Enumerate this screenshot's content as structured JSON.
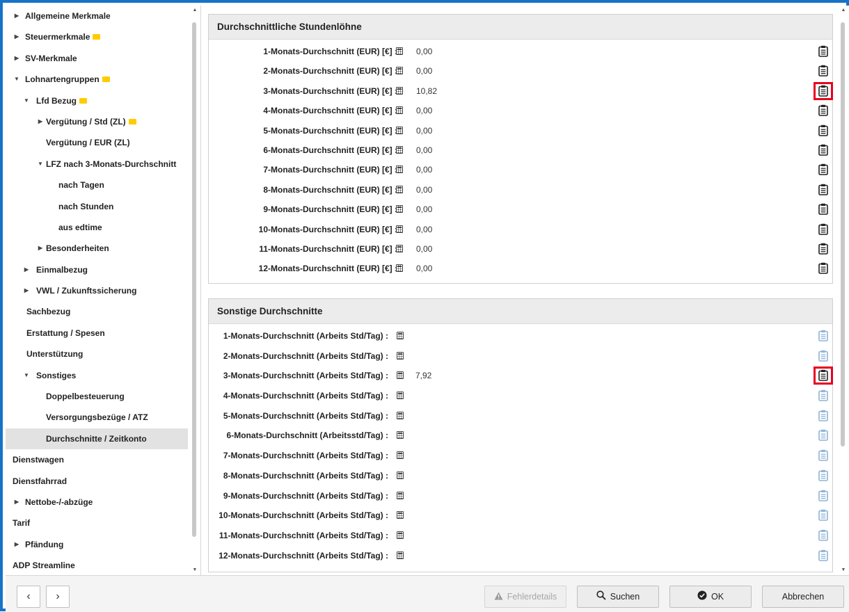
{
  "sidebar": {
    "items": [
      {
        "label": "Allgemeine Merkmale",
        "arrow": "▶",
        "level": 0,
        "flag": false
      },
      {
        "label": "Steuermerkmale",
        "arrow": "▶",
        "level": 0,
        "flag": true
      },
      {
        "label": "SV-Merkmale",
        "arrow": "▶",
        "level": 0,
        "flag": false
      },
      {
        "label": "Lohnartengruppen",
        "arrow": "▼",
        "level": 0,
        "flag": true
      },
      {
        "label": "Lfd Bezug",
        "arrow": "▼",
        "level": 1,
        "flag": true
      },
      {
        "label": "Vergütung / Std (ZL)",
        "arrow": "▶",
        "level": 2,
        "flag": true
      },
      {
        "label": "Vergütung / EUR (ZL)",
        "arrow": "",
        "level": 2,
        "flag": false
      },
      {
        "label": "LFZ nach 3-Monats-Durchschnitt",
        "arrow": "▼",
        "level": 2,
        "flag": false
      },
      {
        "label": "nach Tagen",
        "arrow": "",
        "level": 3,
        "flag": false
      },
      {
        "label": "nach Stunden",
        "arrow": "",
        "level": 3,
        "flag": false
      },
      {
        "label": "aus edtime",
        "arrow": "",
        "level": 3,
        "flag": false
      },
      {
        "label": "Besonderheiten",
        "arrow": "▶",
        "level": 2,
        "flag": false
      },
      {
        "label": "Einmalbezug",
        "arrow": "▶",
        "level": 1,
        "flag": false
      },
      {
        "label": "VWL / Zukunftssicherung",
        "arrow": "▶",
        "level": 1,
        "flag": false
      },
      {
        "label": "Sachbezug",
        "arrow": "",
        "level": 1,
        "flag": false
      },
      {
        "label": "Erstattung / Spesen",
        "arrow": "",
        "level": 1,
        "flag": false
      },
      {
        "label": "Unterstützung",
        "arrow": "",
        "level": 1,
        "flag": false
      },
      {
        "label": "Sonstiges",
        "arrow": "▼",
        "level": 1,
        "flag": false
      },
      {
        "label": "Doppelbesteuerung",
        "arrow": "",
        "level": 2,
        "flag": false
      },
      {
        "label": "Versorgungsbezüge / ATZ",
        "arrow": "",
        "level": 2,
        "flag": false
      },
      {
        "label": "Durchschnitte / Zeitkonto",
        "arrow": "",
        "level": 2,
        "flag": false,
        "selected": true
      },
      {
        "label": "Dienstwagen",
        "arrow": "",
        "level": 0,
        "flag": false
      },
      {
        "label": "Dienstfahrrad",
        "arrow": "",
        "level": 0,
        "flag": false
      },
      {
        "label": "Nettobe-/-abzüge",
        "arrow": "▶",
        "level": 0,
        "flag": false
      },
      {
        "label": "Tarif",
        "arrow": "",
        "level": 0,
        "flag": false
      },
      {
        "label": "Pfändung",
        "arrow": "▶",
        "level": 0,
        "flag": false
      },
      {
        "label": "ADP Streamline",
        "arrow": "",
        "level": 0,
        "flag": false
      }
    ]
  },
  "panels": {
    "stundenloehne": {
      "title": "Durchschnittliche Stundenlöhne",
      "rows": [
        {
          "label": "1-Monats-Durchschnitt (EUR) [€] :",
          "value": "0,00",
          "active": true,
          "highlight": false
        },
        {
          "label": "2-Monats-Durchschnitt (EUR) [€] :",
          "value": "0,00",
          "active": true,
          "highlight": false
        },
        {
          "label": "3-Monats-Durchschnitt (EUR) [€] :",
          "value": "10,82",
          "active": true,
          "highlight": true
        },
        {
          "label": "4-Monats-Durchschnitt (EUR) [€] :",
          "value": "0,00",
          "active": true,
          "highlight": false
        },
        {
          "label": "5-Monats-Durchschnitt (EUR) [€] :",
          "value": "0,00",
          "active": true,
          "highlight": false
        },
        {
          "label": "6-Monats-Durchschnitt (EUR) [€] :",
          "value": "0,00",
          "active": true,
          "highlight": false
        },
        {
          "label": "7-Monats-Durchschnitt (EUR) [€] :",
          "value": "0,00",
          "active": true,
          "highlight": false
        },
        {
          "label": "8-Monats-Durchschnitt (EUR) [€] :",
          "value": "0,00",
          "active": true,
          "highlight": false
        },
        {
          "label": "9-Monats-Durchschnitt (EUR) [€] :",
          "value": "0,00",
          "active": true,
          "highlight": false
        },
        {
          "label": "10-Monats-Durchschnitt (EUR) [€] :",
          "value": "0,00",
          "active": true,
          "highlight": false
        },
        {
          "label": "11-Monats-Durchschnitt (EUR) [€] :",
          "value": "0,00",
          "active": true,
          "highlight": false
        },
        {
          "label": "12-Monats-Durchschnitt (EUR) [€] :",
          "value": "0,00",
          "active": true,
          "highlight": false
        }
      ]
    },
    "sonstige": {
      "title": "Sonstige Durchschnitte",
      "rows": [
        {
          "label": "1-Monats-Durchschnitt (Arbeits Std/Tag) :",
          "value": "",
          "active": false,
          "highlight": false
        },
        {
          "label": "2-Monats-Durchschnitt (Arbeits Std/Tag) :",
          "value": "",
          "active": false,
          "highlight": false
        },
        {
          "label": "3-Monats-Durchschnitt (Arbeits Std/Tag) :",
          "value": "7,92",
          "active": true,
          "highlight": true
        },
        {
          "label": "4-Monats-Durchschnitt (Arbeits Std/Tag) :",
          "value": "",
          "active": false,
          "highlight": false
        },
        {
          "label": "5-Monats-Durchschnitt (Arbeits Std/Tag) :",
          "value": "",
          "active": false,
          "highlight": false
        },
        {
          "label": "6-Monats-Durchschnitt (Arbeitsstd/Tag) :",
          "value": "",
          "active": false,
          "highlight": false
        },
        {
          "label": "7-Monats-Durchschnitt (Arbeits Std/Tag) :",
          "value": "",
          "active": false,
          "highlight": false
        },
        {
          "label": "8-Monats-Durchschnitt (Arbeits Std/Tag) :",
          "value": "",
          "active": false,
          "highlight": false
        },
        {
          "label": "9-Monats-Durchschnitt (Arbeits Std/Tag) :",
          "value": "",
          "active": false,
          "highlight": false
        },
        {
          "label": "10-Monats-Durchschnitt (Arbeits Std/Tag) :",
          "value": "",
          "active": false,
          "highlight": false
        },
        {
          "label": "11-Monats-Durchschnitt (Arbeits Std/Tag) :",
          "value": "",
          "active": false,
          "highlight": false
        },
        {
          "label": "12-Monats-Durchschnitt (Arbeits Std/Tag) :",
          "value": "",
          "active": false,
          "highlight": false
        }
      ]
    }
  },
  "icons": {
    "row_calc": "calculator-icon",
    "row_action": "clipboard-icon",
    "fehler": "warning-icon",
    "suchen": "search-icon",
    "ok": "check-circle-icon"
  },
  "colors": {
    "window_border": "#1773c7",
    "highlight": "#e8001e",
    "flag": "#ffcc00",
    "clip_active": "#222222",
    "clip_inactive": "#8fb4d6"
  },
  "footer": {
    "prev": "‹",
    "next": "›",
    "fehlerdetails": "Fehlerdetails",
    "suchen": "Suchen",
    "ok": "OK",
    "abbrechen": "Abbrechen"
  }
}
